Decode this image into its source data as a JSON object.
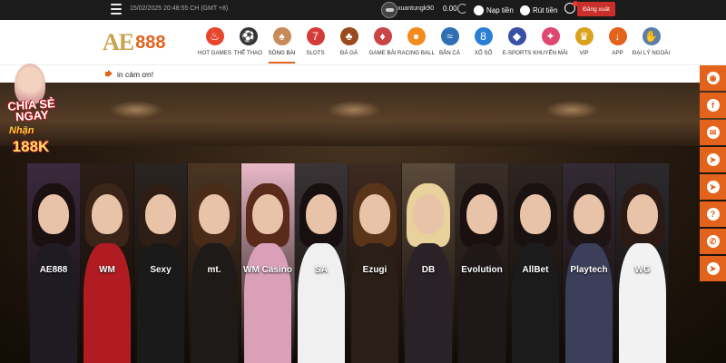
{
  "topbar": {
    "datetime": "15/02/2025 20:48:55 CH (GMT +8)",
    "username": "xuantungk90",
    "balance": "0.00",
    "deposit_label": "Nạp tiền",
    "withdraw_label": "Rút tiền",
    "logout_label": "Đăng xuất"
  },
  "logo": {
    "ae": "AE",
    "num": "888"
  },
  "nav": {
    "items": [
      {
        "label": "HOT GAMES",
        "icon": "flame-icon",
        "color": "#e8452c",
        "glyph": "♨"
      },
      {
        "label": "THỂ THAO",
        "icon": "soccer-ball-icon",
        "color": "#333333",
        "glyph": "⚽"
      },
      {
        "label": "SÒNG BÀI",
        "icon": "casino-dealer-icon",
        "color": "#c98a5a",
        "glyph": "♠"
      },
      {
        "label": "SLOTS",
        "icon": "slot-machine-icon",
        "color": "#d43b3b",
        "glyph": "7"
      },
      {
        "label": "ĐÁ GÀ",
        "icon": "rooster-icon",
        "color": "#9b4a1e",
        "glyph": "♣"
      },
      {
        "label": "GAME BÀI",
        "icon": "playing-cards-icon",
        "color": "#c94545",
        "glyph": "♦"
      },
      {
        "label": "RACING BALL",
        "icon": "racing-ball-icon",
        "color": "#f28b1c",
        "glyph": "●"
      },
      {
        "label": "BẮN CÁ",
        "icon": "fish-icon",
        "color": "#2f6fb3",
        "glyph": "≈"
      },
      {
        "label": "XỔ SỐ",
        "icon": "lottery-ball-icon",
        "color": "#2a7fd4",
        "glyph": "8"
      },
      {
        "label": "E-SPORTS",
        "icon": "gamepad-icon",
        "color": "#3a4fa6",
        "glyph": "◆"
      },
      {
        "label": "KHUYẾN MÃI",
        "icon": "gift-icon",
        "color": "#e04770",
        "glyph": "✦"
      },
      {
        "label": "VIP",
        "icon": "crown-icon",
        "color": "#d9a21c",
        "glyph": "♛"
      },
      {
        "label": "APP",
        "icon": "download-icon",
        "color": "#e3631c",
        "glyph": "↓"
      },
      {
        "label": "ĐẠI LÝ NGOÀI",
        "icon": "handshake-icon",
        "color": "#5c7fa8",
        "glyph": "✋"
      }
    ],
    "active_index": 2
  },
  "announcement": {
    "text": "in cảm ơn!"
  },
  "promo": {
    "line1": "CHIA SẺ NGAY",
    "line2": "Nhận",
    "line3": "188K"
  },
  "providers": [
    {
      "name": "AE888",
      "bg": "#3a2a3e",
      "hair": "#1a1010",
      "body": "#1f1b22"
    },
    {
      "name": "WM",
      "bg": "#2b1d16",
      "hair": "#3b2418",
      "body": "#b01c22"
    },
    {
      "name": "Sexy",
      "bg": "#2a2420",
      "hair": "#2e1d14",
      "body": "#1a1a1a"
    },
    {
      "name": "mt.",
      "bg": "#4a3522",
      "hair": "#4a2a18",
      "body": "#1e1a18"
    },
    {
      "name": "WM Casino",
      "bg": "#e8b8c8",
      "hair": "#5a2a1a",
      "body": "#d9a0b8"
    },
    {
      "name": "SA",
      "bg": "#3a3436",
      "hair": "#181010",
      "body": "#f0f0f0"
    },
    {
      "name": "Ezugi",
      "bg": "#3d2a20",
      "hair": "#5a3418",
      "body": "#2a1e18"
    },
    {
      "name": "DB",
      "bg": "#5a4a3a",
      "hair": "#e8d19a",
      "body": "#2a2226"
    },
    {
      "name": "Evolution",
      "bg": "#3a2e28",
      "hair": "#1a1010",
      "body": "#201818"
    },
    {
      "name": "AllBet",
      "bg": "#2e2420",
      "hair": "#1a1210",
      "body": "#1b1b1b"
    },
    {
      "name": "Playtech",
      "bg": "#332a34",
      "hair": "#1e1414",
      "body": "#3b3f5a"
    },
    {
      "name": "WG",
      "bg": "#2c2a2e",
      "hair": "#2b1a14",
      "body": "#f2f2f2"
    }
  ],
  "sidebar": [
    {
      "icon": "ae888-chat-icon",
      "glyph": "◉"
    },
    {
      "icon": "facebook-icon",
      "glyph": "f"
    },
    {
      "icon": "messenger-icon",
      "glyph": "✉"
    },
    {
      "icon": "telegram-icon",
      "glyph": "➤"
    },
    {
      "icon": "telegram-icon",
      "glyph": "➤"
    },
    {
      "icon": "help-icon",
      "glyph": "?"
    },
    {
      "icon": "phone-icon",
      "glyph": "✆"
    },
    {
      "icon": "telegram-icon",
      "glyph": "➤"
    }
  ]
}
